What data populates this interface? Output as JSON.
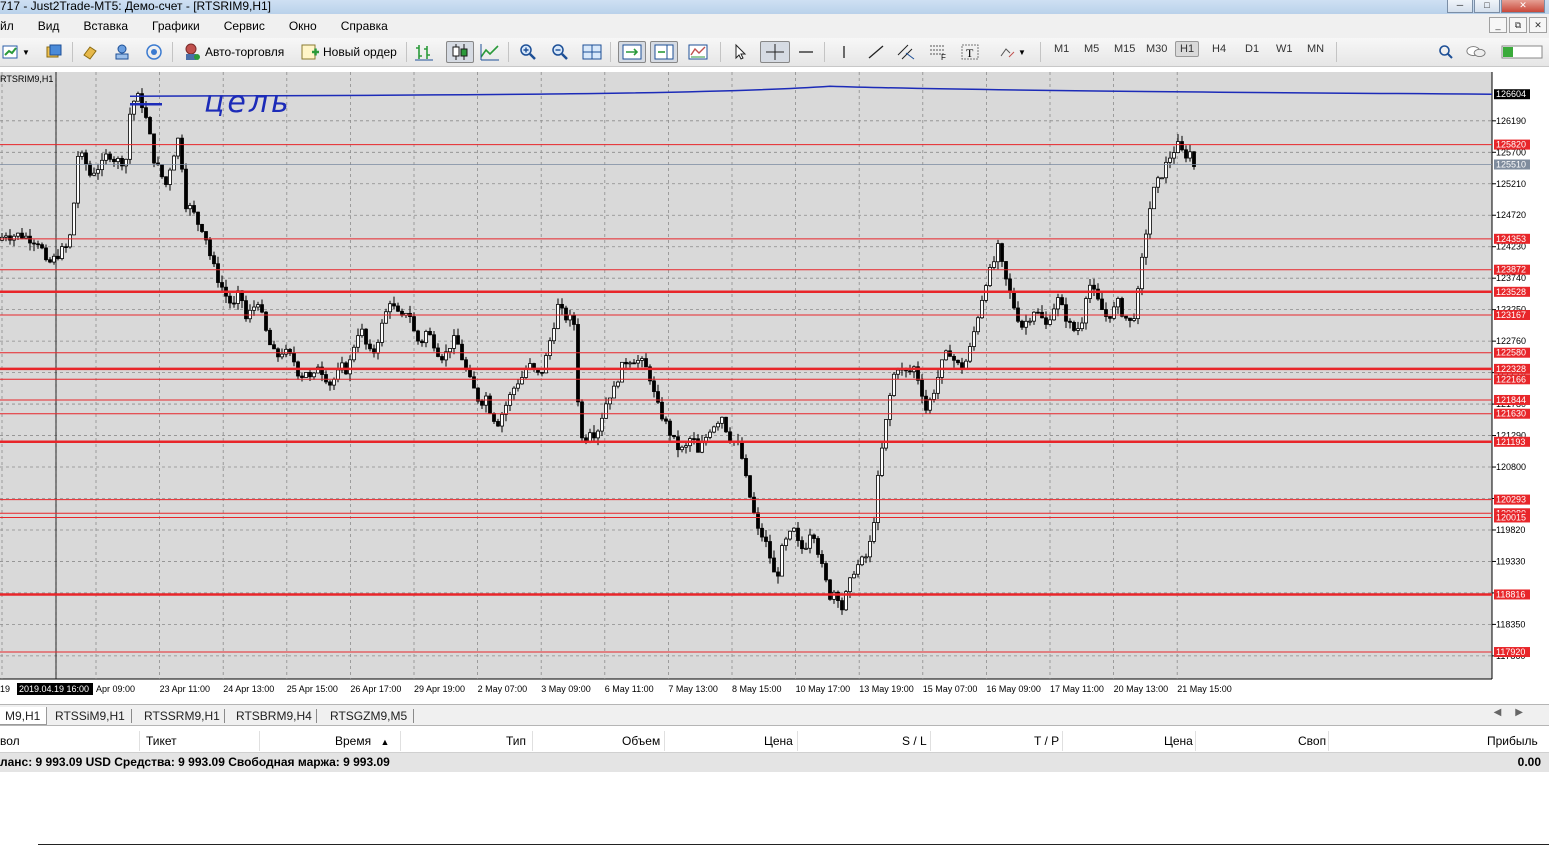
{
  "window": {
    "title": "717 - Just2Trade-MT5: Демо-счет - [RTSRIM9,H1]",
    "minimize": "─",
    "maximize": "□",
    "close": "✕"
  },
  "menu": {
    "items": [
      "йл",
      "Вид",
      "Вставка",
      "Графики",
      "Сервис",
      "Окно",
      "Справка"
    ],
    "mdi": [
      "_",
      "⧉",
      "✕"
    ]
  },
  "toolbar": {
    "autotrade_label": "Авто-торговля",
    "neworder_label": "Новый ордер",
    "timeframes": [
      "M1",
      "M5",
      "M15",
      "M30",
      "H1",
      "H4",
      "D1",
      "W1",
      "MN"
    ],
    "active_timeframe": "H1"
  },
  "chart": {
    "symbol_label": "RTSRIM9,H1",
    "annotation_text": "цель",
    "cursor_time": "2019.04.19 16:00",
    "bg_color": "#d9d9d9",
    "level_color": "#e8262a",
    "candle_color": "#000000",
    "grid_color": "#8c8c8c"
  },
  "chart_data": {
    "type": "candlestick",
    "symbol": "RTSRIM9",
    "timeframe": "H1",
    "y_ticks": [
      126190,
      125700,
      125210,
      124720,
      124230,
      123740,
      123250,
      122760,
      122270,
      121780,
      121290,
      120800,
      120310,
      119820,
      119330,
      118840,
      118350,
      117860
    ],
    "x_ticks": [
      "19",
      "2019.04.19 16:00",
      "Apr 09:00",
      "23 Apr 11:00",
      "24 Apr 13:00",
      "25 Apr 15:00",
      "26 Apr 17:00",
      "29 Apr 19:00",
      "2 May 07:00",
      "3 May 09:00",
      "6 May 11:00",
      "7 May 13:00",
      "8 May 15:00",
      "10 May 17:00",
      "13 May 19:00",
      "15 May 07:00",
      "16 May 09:00",
      "17 May 11:00",
      "20 May 13:00",
      "21 May 15:00"
    ],
    "ylim": [
      117500,
      126950
    ],
    "current_price": 125510,
    "top_line_price": 126604,
    "levels": [
      {
        "price": 125820,
        "bold": false
      },
      {
        "price": 124353,
        "bold": false
      },
      {
        "price": 123872,
        "bold": false
      },
      {
        "price": 123528,
        "bold": true
      },
      {
        "price": 123167,
        "bold": false
      },
      {
        "price": 122580,
        "bold": false
      },
      {
        "price": 122328,
        "bold": true
      },
      {
        "price": 122166,
        "bold": false
      },
      {
        "price": 121844,
        "bold": false
      },
      {
        "price": 121630,
        "bold": false
      },
      {
        "price": 121193,
        "bold": true
      },
      {
        "price": 120293,
        "bold": false
      },
      {
        "price": 120080,
        "bold": false
      },
      {
        "price": 120015,
        "bold": false
      },
      {
        "price": 118816,
        "bold": true
      },
      {
        "price": 117920,
        "bold": false
      }
    ],
    "price_path": [
      [
        0,
        124330
      ],
      [
        5,
        124450
      ],
      [
        10,
        124400
      ],
      [
        20,
        124420
      ],
      [
        30,
        124360
      ],
      [
        40,
        124300
      ],
      [
        46,
        123950
      ],
      [
        52,
        124000
      ],
      [
        60,
        124150
      ],
      [
        68,
        124230
      ],
      [
        72,
        124550
      ],
      [
        78,
        125650
      ],
      [
        84,
        125600
      ],
      [
        90,
        125350
      ],
      [
        96,
        125450
      ],
      [
        102,
        125500
      ],
      [
        108,
        125700
      ],
      [
        114,
        125600
      ],
      [
        120,
        125550
      ],
      [
        126,
        125600
      ],
      [
        130,
        126300
      ],
      [
        136,
        126600
      ],
      [
        142,
        126450
      ],
      [
        148,
        126100
      ],
      [
        154,
        125600
      ],
      [
        160,
        125380
      ],
      [
        166,
        125200
      ],
      [
        172,
        125600
      ],
      [
        178,
        125900
      ],
      [
        182,
        125500
      ],
      [
        186,
        124900
      ],
      [
        192,
        124800
      ],
      [
        198,
        124600
      ],
      [
        204,
        124500
      ],
      [
        210,
        124100
      ],
      [
        216,
        123800
      ],
      [
        222,
        123600
      ],
      [
        228,
        123400
      ],
      [
        234,
        123300
      ],
      [
        240,
        123550
      ],
      [
        246,
        123100
      ],
      [
        252,
        123250
      ],
      [
        258,
        123400
      ],
      [
        264,
        123000
      ],
      [
        270,
        122700
      ],
      [
        276,
        122500
      ],
      [
        282,
        122600
      ],
      [
        288,
        122550
      ],
      [
        294,
        122450
      ],
      [
        300,
        122200
      ],
      [
        306,
        122300
      ],
      [
        312,
        122100
      ],
      [
        318,
        122400
      ],
      [
        324,
        122250
      ],
      [
        330,
        122100
      ],
      [
        336,
        122200
      ],
      [
        342,
        122350
      ],
      [
        348,
        122300
      ],
      [
        354,
        122700
      ],
      [
        360,
        123000
      ],
      [
        366,
        122700
      ],
      [
        372,
        122500
      ],
      [
        378,
        122800
      ],
      [
        384,
        123100
      ],
      [
        390,
        123400
      ],
      [
        396,
        123200
      ],
      [
        402,
        123100
      ],
      [
        408,
        123300
      ],
      [
        414,
        122900
      ],
      [
        420,
        122700
      ],
      [
        426,
        122900
      ],
      [
        432,
        122800
      ],
      [
        438,
        122600
      ],
      [
        444,
        122500
      ],
      [
        450,
        122700
      ],
      [
        456,
        122800
      ],
      [
        462,
        122500
      ],
      [
        468,
        122200
      ],
      [
        474,
        122000
      ],
      [
        480,
        121800
      ],
      [
        486,
        121900
      ],
      [
        492,
        121600
      ],
      [
        498,
        121500
      ],
      [
        504,
        121700
      ],
      [
        510,
        121900
      ],
      [
        516,
        122100
      ],
      [
        522,
        122200
      ],
      [
        528,
        122400
      ],
      [
        534,
        122300
      ],
      [
        540,
        122200
      ],
      [
        546,
        122500
      ],
      [
        552,
        122900
      ],
      [
        558,
        123300
      ],
      [
        564,
        123150
      ],
      [
        570,
        123100
      ],
      [
        576,
        123000
      ],
      [
        579,
        121300
      ],
      [
        584,
        121200
      ],
      [
        590,
        121400
      ],
      [
        596,
        121300
      ],
      [
        602,
        121600
      ],
      [
        608,
        121900
      ],
      [
        614,
        122000
      ],
      [
        620,
        122300
      ],
      [
        626,
        122450
      ],
      [
        632,
        122500
      ],
      [
        638,
        122450
      ],
      [
        644,
        122400
      ],
      [
        650,
        122200
      ],
      [
        656,
        121800
      ],
      [
        662,
        121600
      ],
      [
        668,
        121400
      ],
      [
        674,
        121200
      ],
      [
        680,
        121050
      ],
      [
        686,
        121100
      ],
      [
        692,
        121300
      ],
      [
        698,
        121000
      ],
      [
        704,
        121200
      ],
      [
        710,
        121400
      ],
      [
        716,
        121500
      ],
      [
        722,
        121600
      ],
      [
        728,
        121300
      ],
      [
        734,
        121200
      ],
      [
        740,
        121100
      ],
      [
        746,
        120600
      ],
      [
        752,
        120200
      ],
      [
        758,
        119800
      ],
      [
        764,
        119700
      ],
      [
        770,
        119400
      ],
      [
        776,
        119000
      ],
      [
        782,
        119500
      ],
      [
        788,
        119700
      ],
      [
        794,
        119800
      ],
      [
        800,
        119500
      ],
      [
        806,
        119600
      ],
      [
        812,
        119900
      ],
      [
        818,
        119500
      ],
      [
        824,
        119100
      ],
      [
        830,
        118800
      ],
      [
        836,
        118900
      ],
      [
        842,
        118600
      ],
      [
        848,
        118900
      ],
      [
        854,
        119200
      ],
      [
        860,
        119300
      ],
      [
        866,
        119400
      ],
      [
        872,
        119700
      ],
      [
        878,
        120600
      ],
      [
        884,
        121300
      ],
      [
        890,
        121900
      ],
      [
        896,
        122400
      ],
      [
        902,
        122300
      ],
      [
        908,
        122250
      ],
      [
        914,
        122350
      ],
      [
        920,
        122100
      ],
      [
        926,
        121700
      ],
      [
        932,
        121900
      ],
      [
        938,
        122200
      ],
      [
        944,
        122500
      ],
      [
        950,
        122600
      ],
      [
        956,
        122400
      ],
      [
        962,
        122350
      ],
      [
        968,
        122500
      ],
      [
        974,
        122900
      ],
      [
        980,
        123300
      ],
      [
        986,
        123700
      ],
      [
        992,
        123900
      ],
      [
        998,
        124200
      ],
      [
        1004,
        123800
      ],
      [
        1010,
        123500
      ],
      [
        1016,
        123200
      ],
      [
        1022,
        123000
      ],
      [
        1028,
        123100
      ],
      [
        1034,
        123250
      ],
      [
        1040,
        123150
      ],
      [
        1046,
        123000
      ],
      [
        1052,
        123250
      ],
      [
        1058,
        123400
      ],
      [
        1064,
        123200
      ],
      [
        1070,
        123000
      ],
      [
        1076,
        122900
      ],
      [
        1082,
        123100
      ],
      [
        1088,
        123700
      ],
      [
        1094,
        123500
      ],
      [
        1100,
        123300
      ],
      [
        1106,
        123150
      ],
      [
        1112,
        123200
      ],
      [
        1118,
        123350
      ],
      [
        1124,
        123150
      ],
      [
        1130,
        123050
      ],
      [
        1136,
        123250
      ],
      [
        1142,
        124000
      ],
      [
        1148,
        124700
      ],
      [
        1154,
        125100
      ],
      [
        1160,
        125300
      ],
      [
        1166,
        125500
      ],
      [
        1172,
        125700
      ],
      [
        1178,
        125800
      ],
      [
        1184,
        125650
      ],
      [
        1190,
        125700
      ],
      [
        1194,
        125500
      ]
    ]
  },
  "tabs": {
    "items": [
      "M9,H1",
      "RTSSiM9,H1",
      "RTSSRM9,H1",
      "RTSBRM9,H4",
      "RTSGZM9,M5"
    ],
    "active_index": 0,
    "arrows": "◀▶"
  },
  "terminal": {
    "columns": [
      "вол",
      "Тикет",
      "Время",
      "Тип",
      "Объем",
      "Цена",
      "S / L",
      "T / P",
      "Цена",
      "Своп",
      "Прибыль"
    ],
    "sort_indicator": "▲",
    "balance_text": "ланс: 9 993.09 USD  Средства: 9 993.09  Свободная маржа: 9 993.09",
    "profit_total": "0.00"
  }
}
